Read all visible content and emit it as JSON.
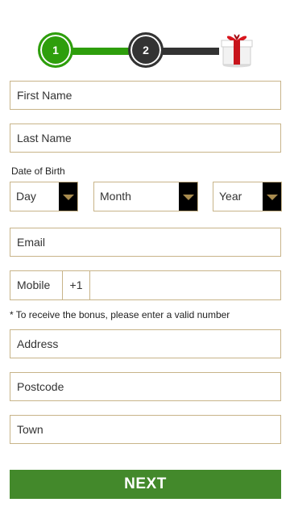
{
  "stepper": {
    "step1_label": "1",
    "step2_label": "2",
    "gift_icon": "gift-icon",
    "colors": {
      "done": "#2e9e0c",
      "todo": "#333333"
    }
  },
  "form": {
    "first_name_placeholder": "First Name",
    "last_name_placeholder": "Last Name",
    "dob_label": "Date of Birth",
    "day_placeholder": "Day",
    "month_placeholder": "Month",
    "year_placeholder": "Year",
    "email_placeholder": "Email",
    "mobile_label": "Mobile",
    "mobile_code": "+1",
    "mobile_note": "* To receive the bonus, please enter a valid number",
    "address_placeholder": "Address",
    "postcode_placeholder": "Postcode",
    "town_placeholder": "Town"
  },
  "actions": {
    "next_label": "NEXT",
    "next_color": "#43892b"
  },
  "border_color": "#c8b489"
}
